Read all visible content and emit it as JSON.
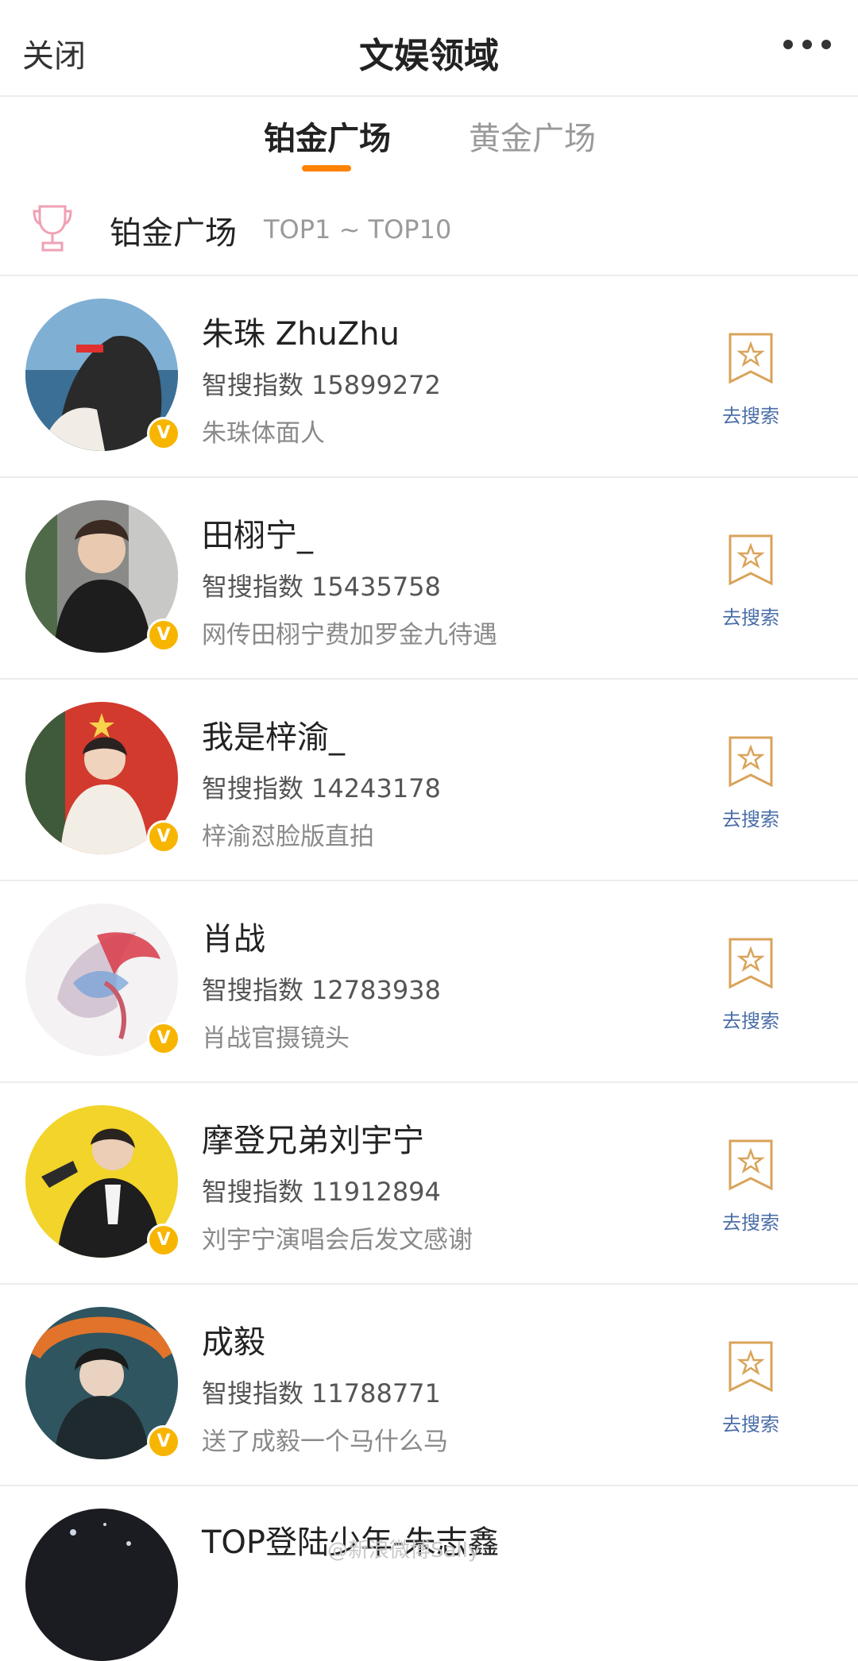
{
  "navbar": {
    "close_label": "关闭",
    "title": "文娱领域",
    "more_icon": "more-dots-icon"
  },
  "tabs": [
    {
      "label": "铂金广场",
      "active": true
    },
    {
      "label": "黄金广场",
      "active": false
    }
  ],
  "colors": {
    "accent": "#ff8200",
    "verified": "#f7b500",
    "search_link": "#4a6ea8",
    "trophy": "#f0a0b4"
  },
  "section": {
    "title": "铂金广场",
    "range": "TOP1 ~ TOP10",
    "icon": "trophy-icon"
  },
  "index_label": "智搜指数",
  "search_label": "去搜索",
  "items": [
    {
      "name": "朱珠 ZhuZhu",
      "index_value": "15899272",
      "desc": "朱珠体面人"
    },
    {
      "name": "田栩宁_",
      "index_value": "15435758",
      "desc": "网传田栩宁费加罗金九待遇"
    },
    {
      "name": "我是梓渝_",
      "index_value": "14243178",
      "desc": "梓渝怼脸版直拍"
    },
    {
      "name": "肖战",
      "index_value": "12783938",
      "desc": "肖战官摄镜头"
    },
    {
      "name": "摩登兄弟刘宇宁",
      "index_value": "11912894",
      "desc": "刘宇宁演唱会后发文感谢"
    },
    {
      "name": "成毅",
      "index_value": "11788771",
      "desc": "送了成毅一个马什么马"
    },
    {
      "name": "TOP登陆少年-朱志鑫"
    }
  ],
  "watermark": "@新浪微博Sally"
}
